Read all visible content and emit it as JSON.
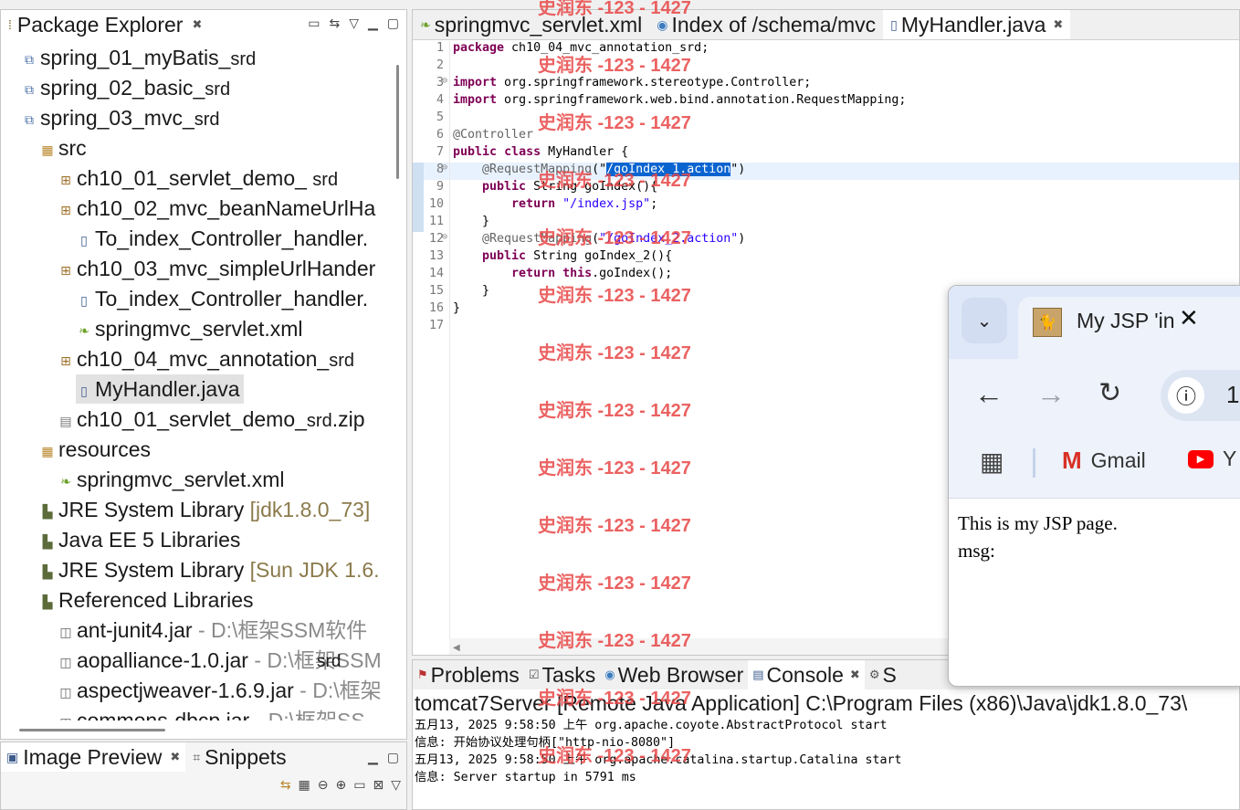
{
  "package_explorer": {
    "title": "Package Explorer",
    "items": [
      {
        "label": "spring_01_myBatis_",
        "suffix": "srd",
        "icon": "project-icon"
      },
      {
        "label": "spring_02_basic_",
        "suffix": "srd",
        "icon": "project-icon"
      },
      {
        "label": "spring_03_mvc_",
        "suffix": "srd",
        "icon": "project-icon"
      },
      {
        "label": "src",
        "icon": "source-folder-icon"
      },
      {
        "label": "ch10_01_servlet_demo_ ",
        "suffix": "srd",
        "icon": "package-icon"
      },
      {
        "label": "ch10_02_mvc_beanNameUrlHa",
        "icon": "package-icon"
      },
      {
        "label": "To_index_Controller_handler.",
        "icon": "java-file-icon"
      },
      {
        "label": "ch10_03_mvc_simpleUrlHander",
        "icon": "package-icon"
      },
      {
        "label": "To_index_Controller_handler.",
        "icon": "java-file-icon"
      },
      {
        "label": "springmvc_servlet.xml",
        "icon": "xml-file-icon"
      },
      {
        "label": "ch10_04_mvc_annotation_",
        "suffix": "srd",
        "icon": "package-icon"
      },
      {
        "label": "MyHandler.java",
        "icon": "java-file-icon"
      },
      {
        "label": "ch10_01_servlet_demo_",
        "suffix": "srd",
        "suffix2": ".zip",
        "icon": "zip-file-icon"
      },
      {
        "label": "resources",
        "icon": "source-folder-icon"
      },
      {
        "label": "springmvc_servlet.xml",
        "icon": "xml-file-icon"
      },
      {
        "label": "JRE System Library ",
        "decoration": "[jdk1.8.0_73]",
        "icon": "library-icon"
      },
      {
        "label": "Java EE 5 Libraries",
        "icon": "library-icon"
      },
      {
        "label": "JRE System Library ",
        "decoration": "[Sun JDK 1.6.",
        "icon": "library-icon"
      },
      {
        "label": "Referenced Libraries",
        "icon": "library-icon"
      },
      {
        "label": "ant-junit4.jar",
        "path": " - D:\\框架SSM软件",
        "icon": "jar-icon"
      },
      {
        "label": "aopalliance-1.0.jar",
        "path": " - D:\\框架SSM",
        "icon": "jar-icon"
      },
      {
        "label": "aspectjweaver-1.6.9.jar",
        "path": " - D:\\框架",
        "icon": "jar-icon"
      },
      {
        "label": "commons-dbcp.jar",
        "path": " - D:\\框架SS",
        "icon": "jar-icon"
      }
    ],
    "overlay_text": "srd"
  },
  "image_preview": {
    "title": "Image Preview",
    "snippets": "Snippets"
  },
  "editor": {
    "tabs": [
      {
        "label": "springmvc_servlet.xml",
        "icon": "xml-file-icon"
      },
      {
        "label": "Index of /schema/mvc",
        "icon": "globe-icon"
      },
      {
        "label": "MyHandler.java",
        "icon": "java-file-icon"
      }
    ],
    "line_numbers": [
      "1",
      "2",
      "3",
      "4",
      "5",
      "6",
      "7",
      "8",
      "9",
      "10",
      "11",
      "12",
      "13",
      "14",
      "15",
      "16",
      "17"
    ],
    "code": {
      "l1_kw": "package",
      "l1_rest": " ch10_04_mvc_annotation_srd;",
      "l3_kw": "import",
      "l3_rest": " org.springframework.stereotype.Controller;",
      "l4_kw": "import",
      "l4_rest": " org.springframework.web.bind.annotation.RequestMapping;",
      "l6_ann": "@Controller",
      "l7_kw1": "public",
      "l7_kw2": "class",
      "l7_rest": " MyHandler {",
      "l8_ann": "@RequestMapping",
      "l8_open": "(\"",
      "l8_str": "/goIndex_1.action",
      "l8_close": "\")",
      "l9_kw": "public",
      "l9_rest": " String goIndex(){",
      "l10_kw": "return",
      "l10_str": "\"/index.jsp\"",
      "l10_rest": ";",
      "l11": "}",
      "l12_ann": "@RequestMapping",
      "l12_open": "(",
      "l12_str": "\"/goIndex_2.action\"",
      "l12_close": ")",
      "l13_kw": "public",
      "l13_rest": " String goIndex_2(){",
      "l14_kw1": "return",
      "l14_kw2": "this",
      "l14_rest": ".goIndex();",
      "l15": "}",
      "l16": "}"
    }
  },
  "console": {
    "tabs": [
      {
        "label": "Problems",
        "icon": "problems-icon"
      },
      {
        "label": "Tasks",
        "icon": "tasks-icon"
      },
      {
        "label": "Web Browser",
        "icon": "globe-icon"
      },
      {
        "label": "Console",
        "icon": "console-icon"
      },
      {
        "label": "S",
        "icon": "servers-icon"
      }
    ],
    "title": "tomcat7Server [Remote Java Application] C:\\Program Files (x86)\\Java\\jdk1.8.0_73\\",
    "lines": [
      "五月13, 2025 9:58:50 上午 org.apache.coyote.AbstractProtocol start",
      "信息: 开始协议处理句柄[\"http-nio-8080\"]",
      "五月13, 2025 9:58:50 上午 org.apache.catalina.startup.Catalina start",
      "信息: Server startup in 5791 ms"
    ]
  },
  "browser": {
    "tab_title": "My JSP 'in",
    "address_partial": "1",
    "bookmarks": [
      "Gmail",
      "Y"
    ],
    "content_line1": "This is my JSP page.",
    "content_line2": "msg:"
  },
  "watermark": "史润东 -123 - 1427"
}
